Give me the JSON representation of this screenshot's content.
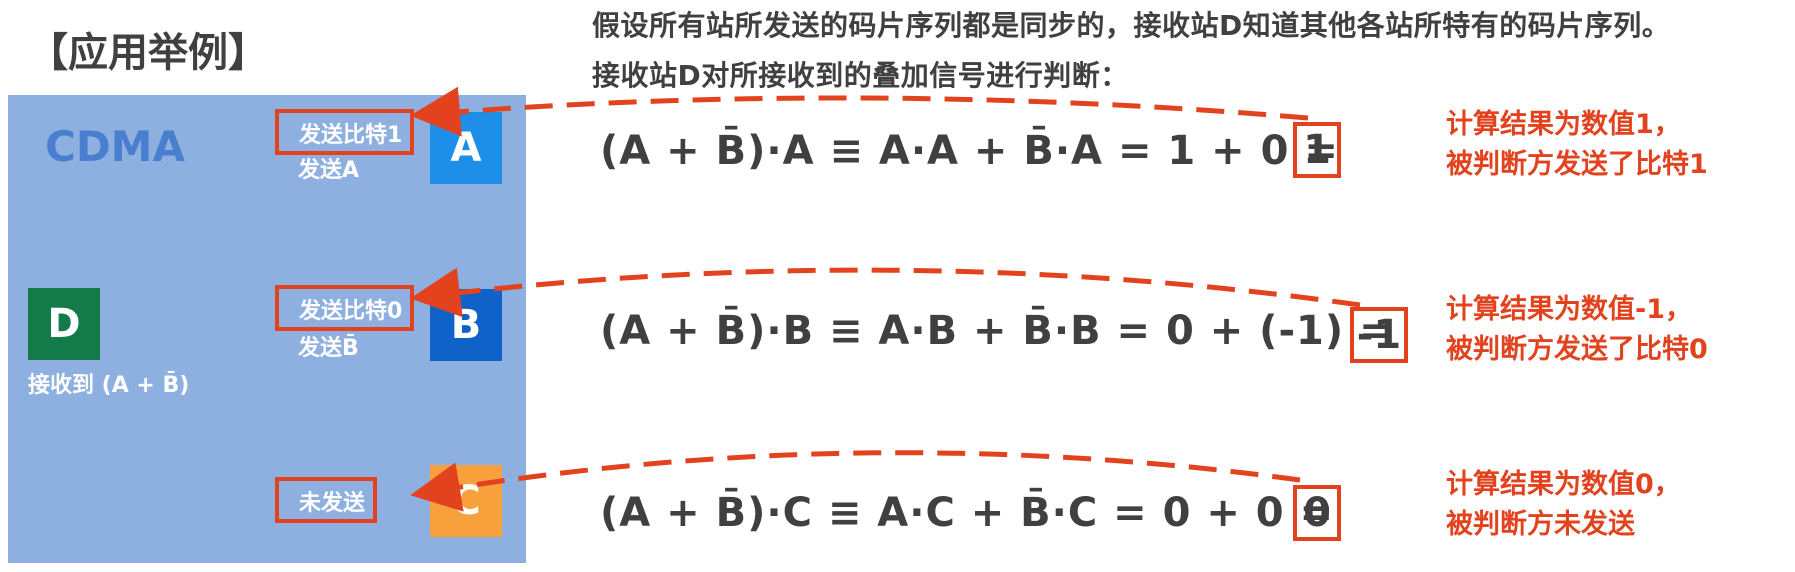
{
  "title": "【应用举例】",
  "intro_line1": "假设所有站所发送的码片序列都是同步的，接收站D知道其他各站所特有的码片序列。",
  "intro_line2": "接收站D对所接收到的叠加信号进行判断：",
  "panel_label": "CDMA",
  "stations": {
    "A": {
      "letter": "A",
      "tag": "发送比特1",
      "sub": "发送A",
      "color": "#1e8fe8"
    },
    "B": {
      "letter": "B",
      "tag": "发送比特0",
      "sub": "发送B̄",
      "color": "#0e62c8"
    },
    "C": {
      "letter": "C",
      "tag": "未发送",
      "color": "#f8a13c"
    },
    "D": {
      "letter": "D",
      "sub": "接收到 (A + B̄)",
      "color": "#137a49"
    }
  },
  "formulas": {
    "A": "(A + B̄)·A ≡ A·A + B̄·A = 1 + 0 =",
    "B": "(A + B̄)·B ≡ A·B + B̄·B = 0 + (-1) =",
    "C": "(A + B̄)·C ≡ A·C + B̄·C = 0 + 0 ="
  },
  "results": {
    "A": "1",
    "B": "-1",
    "C": "0"
  },
  "notes": {
    "A": {
      "line1": "计算结果为数值1，",
      "line2": "被判断方发送了比特1"
    },
    "B": {
      "line1": "计算结果为数值-1，",
      "line2": "被判断方发送了比特0"
    },
    "C": {
      "line1": "计算结果为数值0，",
      "line2": "被判断方未发送"
    }
  },
  "accent_color": "#e2431e"
}
